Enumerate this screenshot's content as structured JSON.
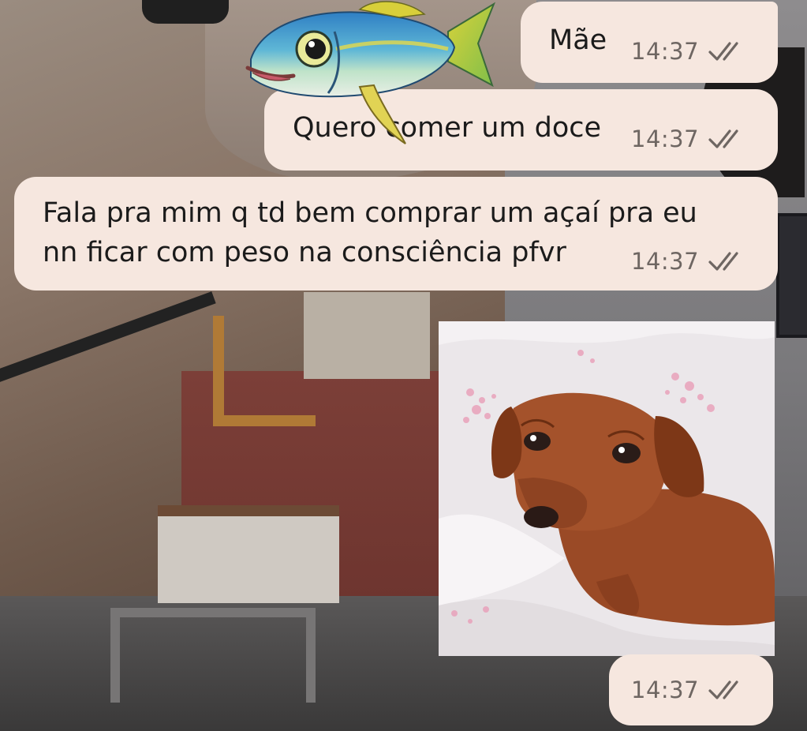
{
  "messages": [
    {
      "text": "Mãe",
      "time": "14:37",
      "status": "read"
    },
    {
      "text": "Quero comer um doce",
      "time": "14:37",
      "status": "read"
    },
    {
      "text": "Fala pra mim q td bem comprar um açaí pra eu\nnn ficar com peso na consciência pfvr",
      "time": "14:37",
      "status": "read"
    },
    {
      "type": "image",
      "image_content": "dachshund-dog-photo",
      "time": "14:37",
      "status": "read"
    }
  ],
  "icons": {
    "read_ticks": "double-check-icon",
    "sticker": "fish-sticker"
  },
  "colors": {
    "bubble": "#f6e7df",
    "time_text": "#6e6662",
    "ticks": "#6e6662",
    "message_text": "#1b1b1b"
  }
}
